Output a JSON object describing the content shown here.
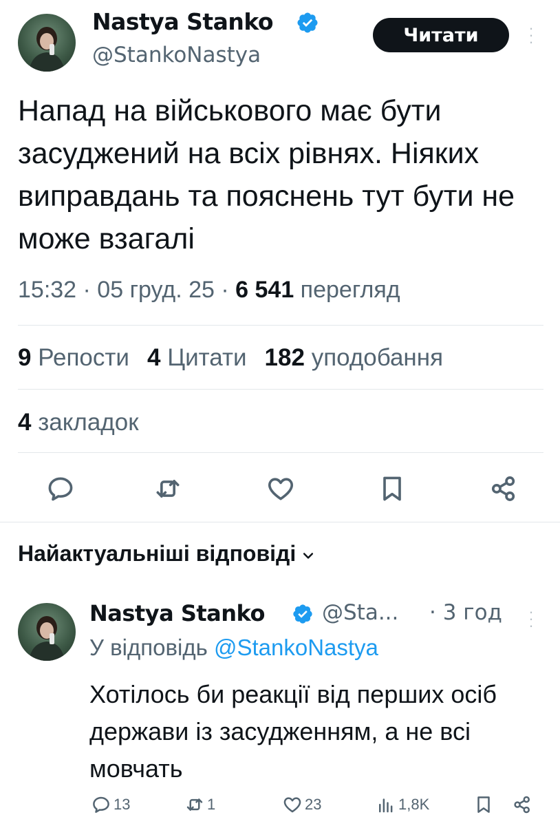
{
  "tweet": {
    "author_name": "Nastya Stanko",
    "author_handle": "@StankoNastya",
    "follow_label": "Читати",
    "text": "Напад на військового має бути засуджений на всіх рівнях. Ніяких виправдань та пояснень тут бути не може взагалі",
    "time": "15:32 · 05 груд. 25 · ",
    "views_count": "6 541",
    "views_label": " перегляд"
  },
  "stats": {
    "reposts_count": "9",
    "reposts_label": "Репости",
    "quotes_count": "4",
    "quotes_label": "Цитати",
    "likes_count": "182",
    "likes_label": "уподобання",
    "bookmarks_count": "4",
    "bookmarks_label": "закладок"
  },
  "replies_section": {
    "title": "Найактуальніші відповіді"
  },
  "reply": {
    "author_name": "Nastya Stanko",
    "author_handle": "@Sta...",
    "time": "· 3 год",
    "reply_to_prefix": "У відповідь ",
    "reply_to_handle": "@StankoNastya",
    "text": "Хотілось би реакції від перших осіб держави із засудженням, а не всі мовчать",
    "replies": "13",
    "reposts": "1",
    "likes": "23",
    "views": "1,8K"
  },
  "colors": {
    "verified": "#1d9bf0",
    "text_primary": "#0f1419",
    "text_secondary": "#536471",
    "link": "#1d9bf0"
  },
  "icons": [
    "verified-badge-icon",
    "more-icon",
    "reply-icon",
    "repost-icon",
    "like-icon",
    "bookmark-icon",
    "share-icon",
    "views-icon",
    "chevron-down-icon"
  ]
}
